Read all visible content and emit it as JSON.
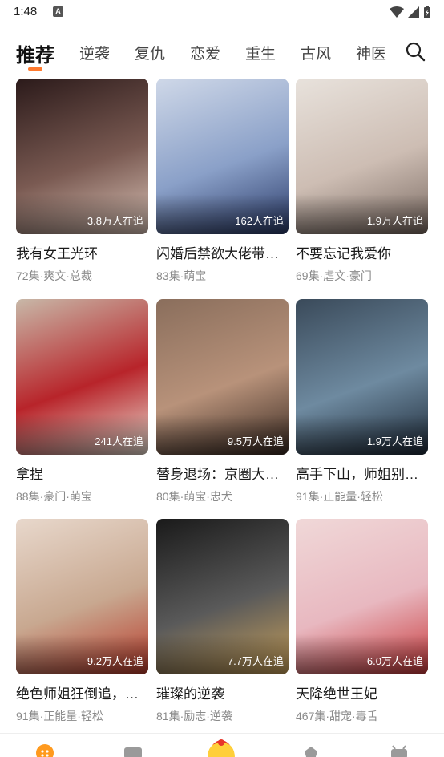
{
  "status": {
    "time": "1:48",
    "notif_letter": "A"
  },
  "tabs": [
    {
      "label": "推荐",
      "active": true
    },
    {
      "label": "逆袭"
    },
    {
      "label": "复仇"
    },
    {
      "label": "恋爱"
    },
    {
      "label": "重生"
    },
    {
      "label": "古风"
    },
    {
      "label": "神医"
    }
  ],
  "dramas": [
    {
      "title": "我有女王光环",
      "meta": "72集·爽文·总裁",
      "followers": "3.8万人在追",
      "colors": [
        "#2b1a1a",
        "#7a5a52",
        "#d9c2b6"
      ]
    },
    {
      "title": "闪婚后禁欲大佬带…",
      "meta": "83集·萌宝",
      "followers": "162人在追",
      "colors": [
        "#cfd8e8",
        "#8aa0c8",
        "#2a3a68"
      ]
    },
    {
      "title": "不要忘记我爱你",
      "meta": "69集·虐文·豪门",
      "followers": "1.9万人在追",
      "colors": [
        "#e8e2dc",
        "#cdbdb3",
        "#7a6a62"
      ]
    },
    {
      "title": "拿捏",
      "meta": "88集·豪门·萌宝",
      "followers": "241人在追",
      "colors": [
        "#c8b8a8",
        "#b8242a",
        "#e8dcd0"
      ]
    },
    {
      "title": "替身退场：京圈大…",
      "meta": "80集·萌宝·忠犬",
      "followers": "9.5万人在追",
      "colors": [
        "#8a6e5c",
        "#b8927a",
        "#3a2a22"
      ]
    },
    {
      "title": "高手下山，师姐别…",
      "meta": "91集·正能量·轻松",
      "followers": "1.9万人在追",
      "colors": [
        "#3a4a5a",
        "#6e8aa0",
        "#1e2a38"
      ]
    },
    {
      "title": "绝色师姐狂倒追，…",
      "meta": "91集·正能量·轻松",
      "followers": "9.2万人在追",
      "colors": [
        "#e8d8cc",
        "#c8a890",
        "#b83a2a"
      ]
    },
    {
      "title": "璀璨的逆袭",
      "meta": "81集·励志·逆袭",
      "followers": "7.7万人在追",
      "colors": [
        "#1a1a1a",
        "#5a5a5a",
        "#c8a05a"
      ]
    },
    {
      "title": "天降绝世王妃",
      "meta": "467集·甜宠·毒舌",
      "followers": "6.0万人在追",
      "colors": [
        "#f0d8d8",
        "#e8b8c0",
        "#c8383a"
      ]
    }
  ],
  "colors": {
    "accent": "#ff7a2e",
    "meta_gray": "#8a8a8a"
  }
}
